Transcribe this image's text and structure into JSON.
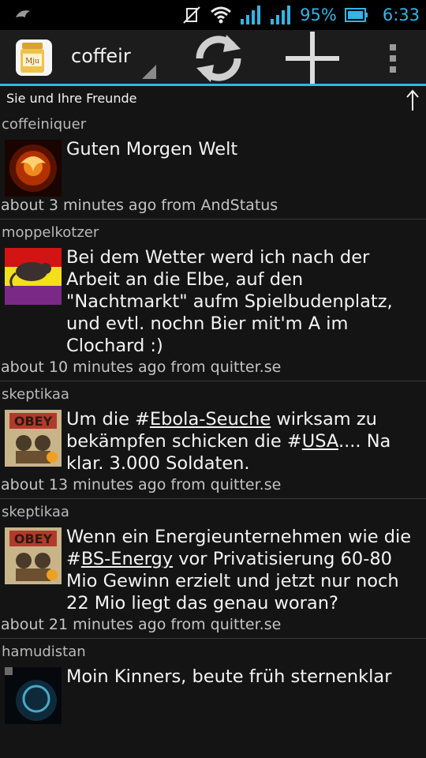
{
  "status_bar": {
    "battery_percent": "95%",
    "time": "6:33",
    "accent_color": "#33b5e5"
  },
  "action_bar": {
    "app_icon_text": "Mju",
    "account_title": "coffeir",
    "buttons": [
      "refresh-icon",
      "add-icon",
      "overflow-menu-icon"
    ]
  },
  "timeline_header": {
    "title": "Sie und Ihre Freunde",
    "up_arrow": "↑"
  },
  "timeline": [
    {
      "author": "coffeiniquer",
      "body": "Guten Morgen Welt",
      "meta": "about 3 minutes ago from AndStatus"
    },
    {
      "author": "moppelkotzer",
      "body": "Bei dem Wetter werd ich nach der Arbeit an die Elbe, auf den \"Nachtmarkt\" aufm Spielbudenplatz, und evtl. nochn Bier mit'm A im Clochard :)",
      "meta": "about 10 minutes ago from quitter.se"
    },
    {
      "author": "skeptikaa",
      "body_parts": [
        "Um die #",
        "Ebola-Seuche",
        " wirksam zu bekämpfen schicken die #",
        "USA",
        ".... Na klar. 3.000 Soldaten."
      ],
      "meta": "about 13 minutes ago from quitter.se"
    },
    {
      "author": "skeptikaa",
      "body_parts": [
        "Wenn ein Energieunternehmen wie die #",
        "BS-Energy",
        " vor Privatisierung 60-80 Mio Gewinn erzielt und jetzt nur noch 22 Mio liegt das genau woran?"
      ],
      "meta": "about 21 minutes ago from quitter.se"
    },
    {
      "author": "hamudistan",
      "body": "Moin Kinners, beute früh sternenklar",
      "meta": ""
    }
  ]
}
